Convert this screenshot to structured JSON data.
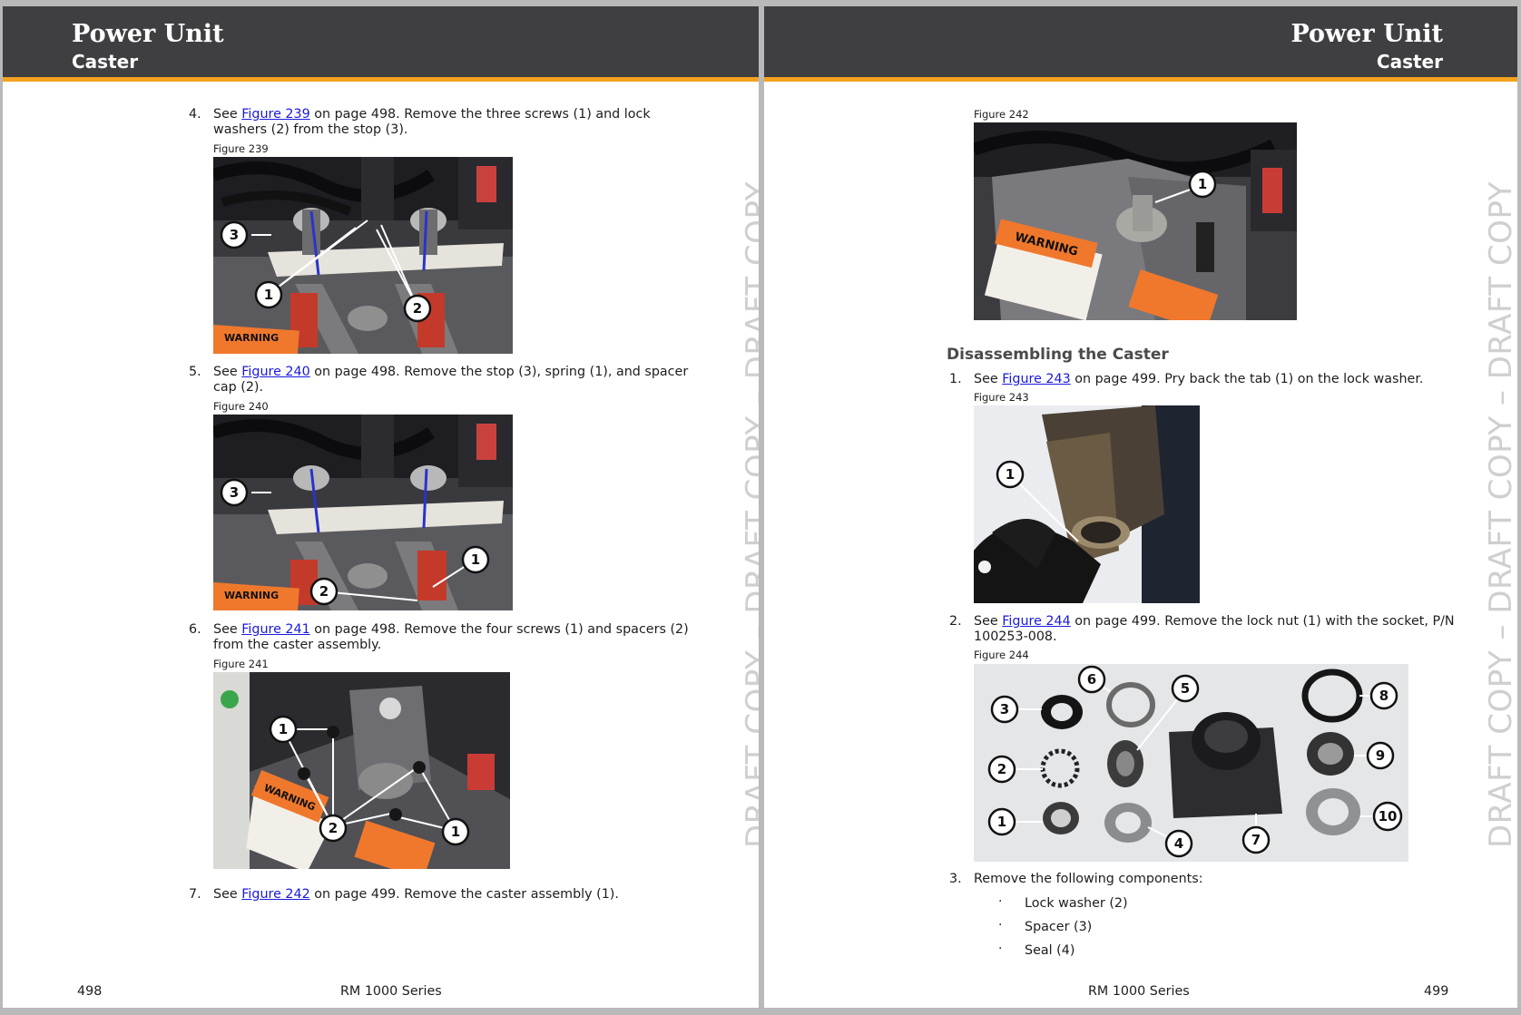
{
  "left_page": {
    "header": {
      "title": "Power Unit",
      "subtitle": "Caster"
    },
    "steps": [
      {
        "num": "4.",
        "pre": "See ",
        "link": "Figure 239",
        "post": " on page 498. Remove the three screws (1) and lock washers (2) from the stop (3)."
      },
      {
        "num": "5.",
        "pre": "See ",
        "link": "Figure 240",
        "post": " on page 498. Remove the stop (3), spring (1), and spacer cap (2)."
      },
      {
        "num": "6.",
        "pre": "See ",
        "link": "Figure 241",
        "post": " on page 498. Remove the four screws (1) and spacers (2) from the caster assembly."
      },
      {
        "num": "7.",
        "pre": "See ",
        "link": "Figure 242",
        "post": " on page 499. Remove the caster assembly (1)."
      }
    ],
    "figures": [
      {
        "label": "Figure 239",
        "callouts": [
          "3",
          "1",
          "2"
        ],
        "warning_text": "WARNING",
        "photo": null
      },
      {
        "label": "Figure 240",
        "callouts": [
          "3",
          "1",
          "2"
        ],
        "warning_text": "WARNING",
        "photo": null
      },
      {
        "label": "Figure 241",
        "callouts": [
          "1",
          "2",
          "1"
        ],
        "warning_text": "WARNING",
        "photo": null
      }
    ],
    "watermark": "DRAFT COPY – DRAFT COPY – DRAFT COPY",
    "footer": {
      "page_number": "498",
      "series": "RM 1000 Series"
    }
  },
  "right_page": {
    "header": {
      "title": "Power Unit",
      "subtitle": "Caster"
    },
    "figure_242": {
      "label": "Figure 242",
      "callouts": [
        "1"
      ],
      "warning_text": "WARNING",
      "photo": null
    },
    "section_heading": "Disassembling the Caster",
    "steps": [
      {
        "num": "1.",
        "pre": "See ",
        "link": "Figure 243",
        "post": " on page 499. Pry back the tab (1) on the lock washer."
      },
      {
        "num": "2.",
        "pre": "See ",
        "link": "Figure 244",
        "post": " on page 499. Remove the lock nut (1) with the socket, P/N 100253-008."
      },
      {
        "num": "3.",
        "pre": "",
        "link": "",
        "post": "Remove the following components:"
      }
    ],
    "figures": [
      {
        "label": "Figure 243",
        "callouts": [
          "1"
        ],
        "photo": null
      },
      {
        "label": "Figure 244",
        "callouts": [
          "1",
          "2",
          "3",
          "4",
          "5",
          "6",
          "7",
          "8",
          "9",
          "10"
        ],
        "photo": null
      }
    ],
    "components": [
      "Lock washer (2)",
      "Spacer (3)",
      "Seal (4)"
    ],
    "watermark": "DRAFT COPY – DRAFT COPY – DRAFT COPY",
    "footer": {
      "page_number": "499",
      "series": "RM 1000 Series"
    }
  },
  "colors": {
    "header_bg": "#3f3f41",
    "header_rule": "#f4a21f",
    "link": "#1a1adb",
    "watermark": "#cfcfcf",
    "warning_orange": "#f0782d"
  }
}
